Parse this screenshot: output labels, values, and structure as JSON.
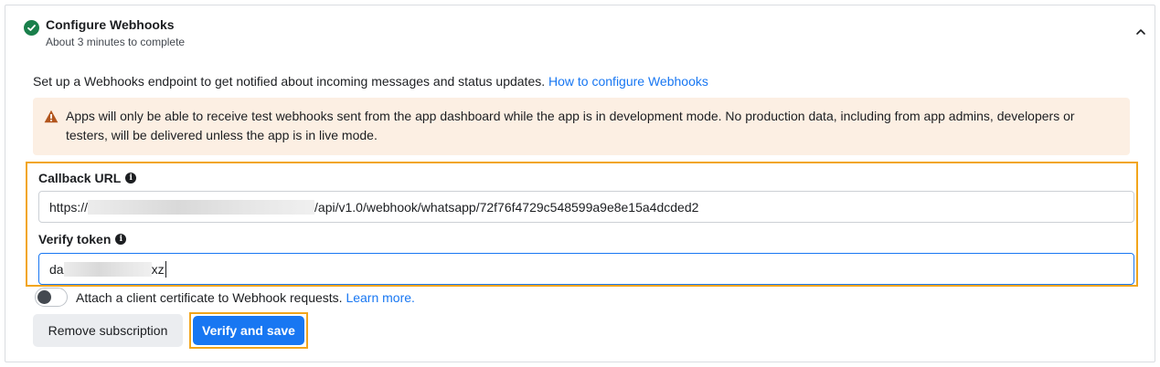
{
  "header": {
    "title": "Configure Webhooks",
    "subtitle": "About 3 minutes to complete"
  },
  "intro": {
    "text": "Set up a Webhooks endpoint to get notified about incoming messages and status updates. ",
    "link": "How to configure Webhooks"
  },
  "alert": {
    "text": "Apps will only be able to receive test webhooks sent from the app dashboard while the app is in development mode. No production data, including from app admins, developers or testers, will be delivered unless the app is in live mode."
  },
  "callback": {
    "label": "Callback URL",
    "value_prefix": "https://",
    "value_suffix": "/api/v1.0/webhook/whatsapp/72f76f4729c548599a9e8e15a4dcded2"
  },
  "verify": {
    "label": "Verify token",
    "value_prefix": "da",
    "value_suffix": "xz"
  },
  "certificate": {
    "label": "Attach a client certificate to Webhook requests. ",
    "link": "Learn more."
  },
  "buttons": {
    "remove": "Remove subscription",
    "verify_save": "Verify and save"
  },
  "colors": {
    "accent": "#1877f2",
    "success": "#1a7f4b",
    "highlight": "#f2a51b",
    "alert_bg": "#fcefe3"
  }
}
